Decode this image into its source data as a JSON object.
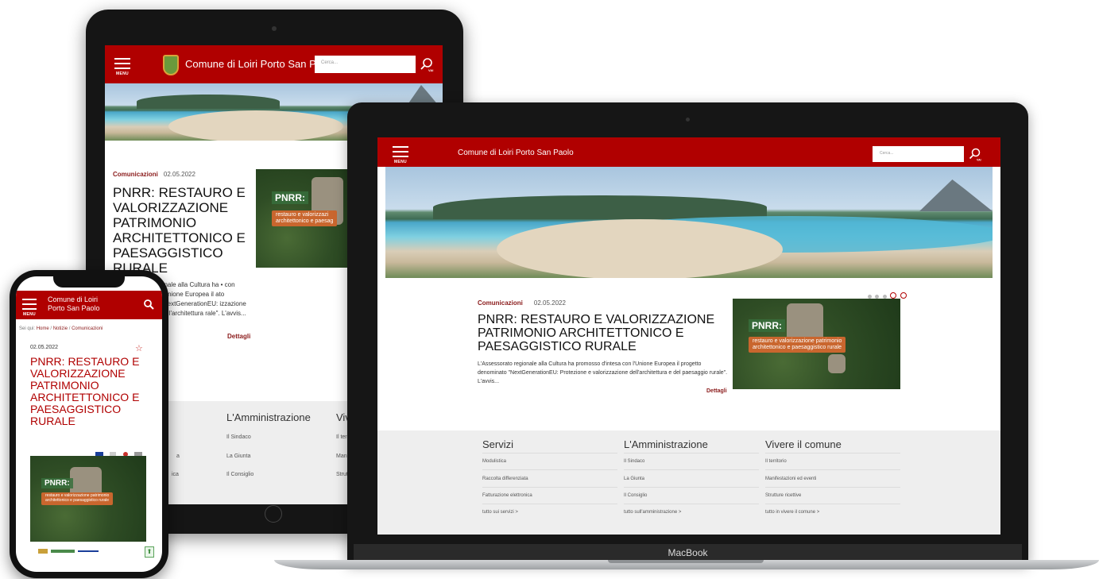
{
  "site": {
    "name": "Comune di Loiri Porto San Paolo",
    "name_line1": "Comune di Loiri",
    "name_line2": "Porto San Paolo",
    "menu_label": "MENU",
    "search_placeholder": "Cerca...",
    "search_btn_label": "VAI"
  },
  "breadcrumb": {
    "prefix": "Sei qui:",
    "items": [
      "Home",
      "Notizie",
      "Comunicazioni"
    ],
    "separator": "/"
  },
  "article": {
    "category": "Comunicazioni",
    "date": "02.05.2022",
    "title": "PNRR: RESTAURO E VALORIZZAZIONE PATRIMONIO ARCHITETTONICO E PAESAGGISTICO RURALE",
    "excerpt": "L'Assessorato regionale alla Cultura ha promosso d'intesa con l'Unione Europea il progetto denominato \"NextGenerationEU: Protezione e valorizzazione dell'architettura e del paesaggio rurale\". L'avvis...",
    "details_label": "Dettagli",
    "tablet_excerpt_fragment": "onale alla Cultura ha • con l'Unione Europea il ato \"NextGenerationEU: izzazione dell'architettura rale\". L'avvis...",
    "image_tag": "PNRR:",
    "image_caption_line1": "restauro e valorizzazione patrimonio",
    "image_caption_line2": "architettonico e paesaggistico rurale",
    "tablet_caption_line1": "restauro e valorizzazi",
    "tablet_caption_line2": "architettonico e paesag"
  },
  "footer": {
    "columns": [
      {
        "heading": "Servizi",
        "items": [
          "Modulistica",
          "Raccolta differenziata",
          "Fatturazione elettronica"
        ],
        "more": "tutto sui servizi >"
      },
      {
        "heading": "L'Amministrazione",
        "items": [
          "Il Sindaco",
          "La Giunta",
          "Il Consiglio"
        ],
        "more": "tutto sull'amministrazione >"
      },
      {
        "heading": "Vivere il comune",
        "items": [
          "Il territorio",
          "Manifestazioni ed eventi",
          "Strutture ricettive"
        ],
        "more": "tutto in vivere il comune >"
      }
    ],
    "tablet_partial": {
      "col1_item2": "a",
      "col1_item3": "ica",
      "col3_heading": "Viv",
      "col3_item1": "Il terr",
      "col3_item2": "Manif",
      "col3_item3": "Strutt"
    }
  },
  "device": {
    "laptop_brand": "MacBook"
  },
  "colors": {
    "brand_red": "#b00000",
    "link_maroon": "#8a1a1a",
    "footer_bg": "#eeeeee",
    "caption_orange": "#c9662e"
  },
  "icons": [
    "hamburger-icon",
    "search-icon",
    "star-icon",
    "crest-icon",
    "arrow-up-icon",
    "carousel-prev-icon",
    "carousel-next-icon"
  ]
}
